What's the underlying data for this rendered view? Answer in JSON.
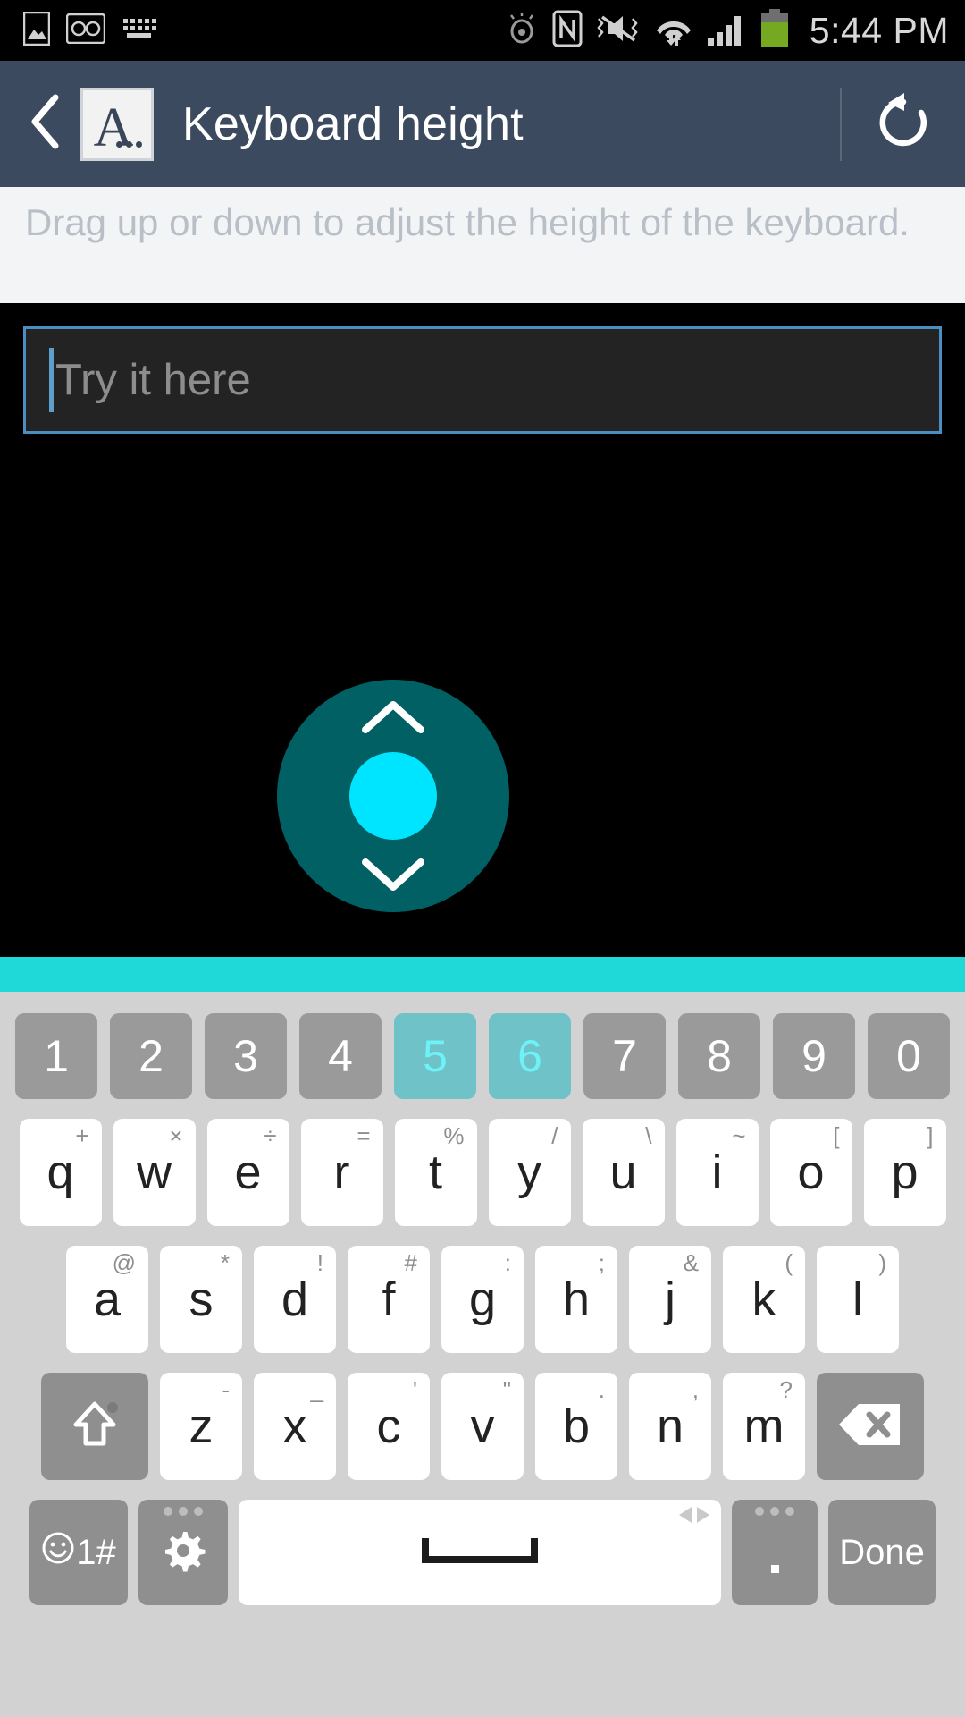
{
  "status_bar": {
    "icons": [
      "image-icon",
      "voicemail-icon",
      "keyboard-icon",
      "eye-icon",
      "nfc-icon",
      "mute-vibrate-icon",
      "wifi-icon",
      "signal-icon",
      "battery-icon"
    ],
    "clock": "5:44 PM"
  },
  "header": {
    "back_icon": "back-chevron-icon",
    "app_icon": "app-letter-a-icon",
    "app_icon_letter": "A",
    "title": "Keyboard height",
    "reset_icon": "reset-undo-icon"
  },
  "instruction": {
    "text": "Drag up or down to adjust the height of the keyboard."
  },
  "try_field": {
    "placeholder": "Try it here",
    "value": "",
    "border_color": "#4a8ec2",
    "background": "#232323"
  },
  "drag_handle": {
    "up_icon": "chevron-up-icon",
    "down_icon": "chevron-down-icon",
    "accent_color": "#00e5ff",
    "divider_color": "#1fd8d8"
  },
  "keyboard": {
    "background": "#d2d2d2",
    "number_row": [
      {
        "label": "1",
        "highlighted": false
      },
      {
        "label": "2",
        "highlighted": false
      },
      {
        "label": "3",
        "highlighted": false
      },
      {
        "label": "4",
        "highlighted": false
      },
      {
        "label": "5",
        "highlighted": true
      },
      {
        "label": "6",
        "highlighted": true
      },
      {
        "label": "7",
        "highlighted": false
      },
      {
        "label": "8",
        "highlighted": false
      },
      {
        "label": "9",
        "highlighted": false
      },
      {
        "label": "0",
        "highlighted": false
      }
    ],
    "top_row": [
      {
        "label": "q",
        "sub": "+"
      },
      {
        "label": "w",
        "sub": "×"
      },
      {
        "label": "e",
        "sub": "÷"
      },
      {
        "label": "r",
        "sub": "="
      },
      {
        "label": "t",
        "sub": "%"
      },
      {
        "label": "y",
        "sub": "/"
      },
      {
        "label": "u",
        "sub": "\\"
      },
      {
        "label": "i",
        "sub": "~"
      },
      {
        "label": "o",
        "sub": "["
      },
      {
        "label": "p",
        "sub": "]"
      }
    ],
    "home_row": [
      {
        "label": "a",
        "sub": "@"
      },
      {
        "label": "s",
        "sub": "*"
      },
      {
        "label": "d",
        "sub": "!"
      },
      {
        "label": "f",
        "sub": "#"
      },
      {
        "label": "g",
        "sub": ":"
      },
      {
        "label": "h",
        "sub": ";"
      },
      {
        "label": "j",
        "sub": "&"
      },
      {
        "label": "k",
        "sub": "("
      },
      {
        "label": "l",
        "sub": ")"
      }
    ],
    "bottom_row": [
      {
        "label": "z",
        "sub": "-"
      },
      {
        "label": "x",
        "sub": "_"
      },
      {
        "label": "c",
        "sub": "'"
      },
      {
        "label": "v",
        "sub": "\""
      },
      {
        "label": "b",
        "sub": "."
      },
      {
        "label": "n",
        "sub": ","
      },
      {
        "label": "m",
        "sub": "?"
      }
    ],
    "shift_key": {
      "icon": "shift-arrow-icon"
    },
    "backspace_key": {
      "icon": "backspace-icon"
    },
    "function_row": {
      "symbol_key": {
        "label": "1#",
        "icon": "emoji-smiley-icon"
      },
      "settings_key": {
        "icon": "gear-icon"
      },
      "space_key": {
        "icon": "space-bar-icon",
        "arrows_icon": "left-right-arrows-icon"
      },
      "period_key": {
        "label": "."
      },
      "done_key": {
        "label": "Done"
      }
    }
  }
}
